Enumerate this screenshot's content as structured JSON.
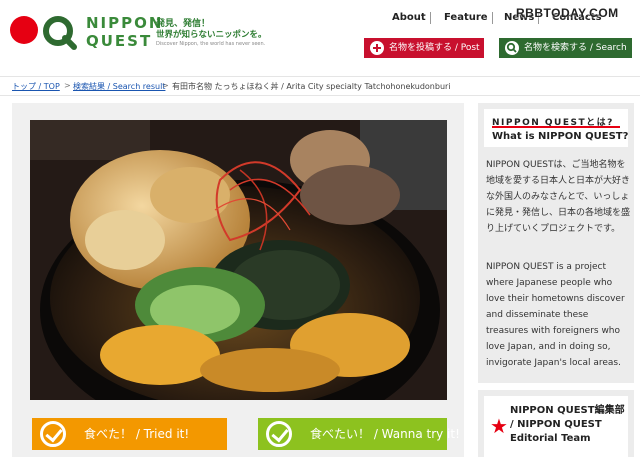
{
  "header": {
    "logo_line1": "NIPPON",
    "logo_line2": "QUEST",
    "tagline_1": "発見、発信！",
    "tagline_2": "世界が知らないニッポンを。",
    "tagline_3": "Discover Nippon, the world has never seen.",
    "nav": [
      "About",
      "Feature",
      "News",
      "Contacts"
    ],
    "watermark": "RBBTODAY.COM",
    "post_button": "名物を投稿する / Post",
    "search_button": "名物を検索する / Search"
  },
  "breadcrumb": {
    "home": "トップ / TOP",
    "search": "検索結果 / Search result",
    "current": "有田市名物 たっちょほねく丼 / Arita City specialty Tatchohonekudonburi",
    "separator": ">"
  },
  "actions": {
    "tried": "食べた！ / Tried it!",
    "wanna": "食べたい！ / Wanna try it!"
  },
  "sidebar": {
    "about_logo": "NIPPON QUESTとは?",
    "about_title": "What is NIPPON QUEST?",
    "about_jp": "NIPPON QUESTは、ご当地名物を地域を愛する日本人と日本が大好きな外国人のみなさんとで、いっしょに発見・発信し、日本の各地域を盛り上げていくプロジェクトです。",
    "about_en": "NIPPON QUEST is a project where Japanese people who love their hometowns discover and disseminate these treasures with foreigners who love Japan, and in doing so, invigorate Japan's local areas.",
    "team_name": "NIPPON QUEST編集部 / NIPPON QUEST Editorial Team"
  },
  "colors": {
    "brand_red": "#e60012",
    "brand_green": "#2e6a30",
    "orange": "#f39800",
    "lime": "#8dc21f",
    "link": "#1a55b0"
  }
}
